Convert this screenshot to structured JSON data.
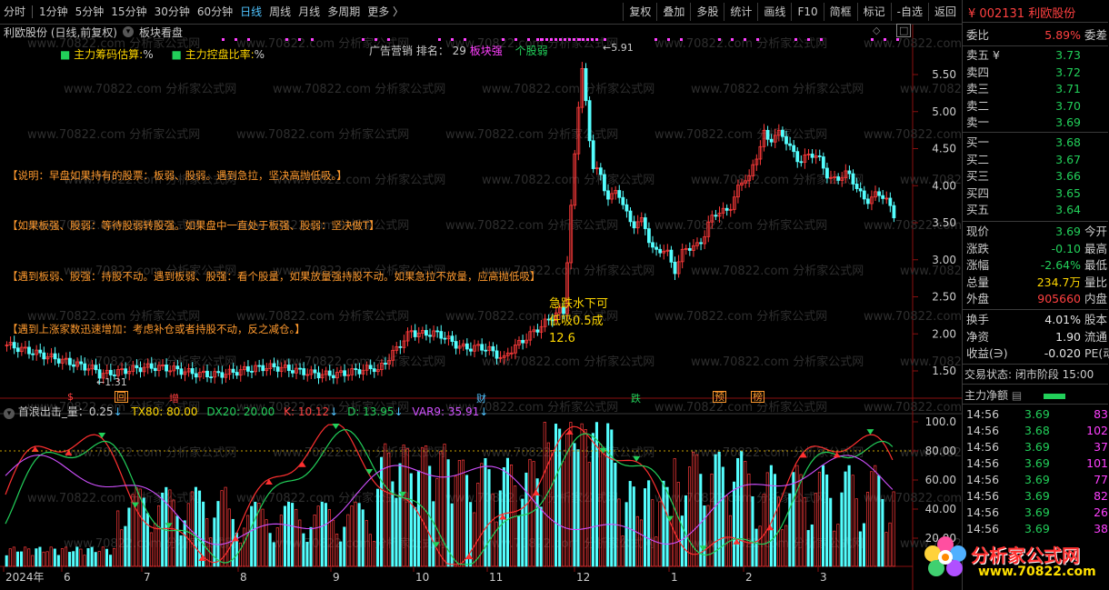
{
  "topbar": {
    "periods": [
      "分时",
      "1分钟",
      "5分钟",
      "15分钟",
      "30分钟",
      "60分钟",
      "日线",
      "周线",
      "月线",
      "多周期",
      "更多 〉"
    ],
    "active_period": "日线",
    "tools": [
      "复权",
      "叠加",
      "多股",
      "统计",
      "画线",
      "F10",
      "简框",
      "标记",
      "-自选",
      "返回"
    ]
  },
  "chart_title": {
    "stock": "利欧股份 (日线,前复权)",
    "selector": "板块看盘"
  },
  "indicators_top": {
    "item1": "主力筹码估算:",
    "item1_val": "%",
    "item2": "主力控盘比率:",
    "item2_val": "%",
    "rank": "广告营销 排名： 29",
    "sector_strong": "板块强",
    "stock_weak": "个股弱"
  },
  "notes": [
    "【说明：早盘如果持有的股票：板弱、股弱。遇到急拉，坚决高抛低吸。】",
    "【如果板强、股弱：等待股弱转股强。如果盘中一直处于板强、股弱：坚决做T】",
    "【遇到板弱、股强：持股不动。遇到板弱、股强：看个股量，如果放量强持股不动。如果急拉不放量，应高抛低吸】",
    "【遇到上涨家数迅速增加：考虑补仓或者持股不动，反之减仓。】"
  ],
  "annotations": {
    "high_label": "5.91",
    "low_label": "1.31",
    "callout_line1": "急跌水下可",
    "callout_line2": "低吸0.5成",
    "callout_line3": "12.6"
  },
  "event_markers": [
    "$",
    "回",
    "增",
    "财",
    "跌",
    "预",
    "榜"
  ],
  "price_axis": [
    "5.50",
    "5.00",
    "4.50",
    "4.00",
    "3.50",
    "3.00",
    "2.50",
    "2.00",
    "1.50"
  ],
  "sub_indicator": {
    "name": "首浪出击_量：0.25",
    "tx80": "TX80: 80.00",
    "dx20": "DX20: 20.00",
    "k": "K: 10.12",
    "d": "D: 13.95",
    "var9": "VAR9: 35.91"
  },
  "sub_axis": [
    "100.0",
    "80.00",
    "60.00",
    "40.00",
    "20.00"
  ],
  "date_axis": [
    "2024年",
    "6",
    "7",
    "8",
    "9",
    "10",
    "11",
    "12",
    "1",
    "2",
    "3"
  ],
  "watermark": "www.70822.com 分析家公式网",
  "right_panel": {
    "code": "002131",
    "name": "利欧股份",
    "weibi_label": "委比",
    "weibi": "5.89%",
    "weicha_label": "委差",
    "asks": [
      {
        "label": "卖五 ¥",
        "price": "3.73"
      },
      {
        "label": "卖四",
        "price": "3.72"
      },
      {
        "label": "卖三",
        "price": "3.71"
      },
      {
        "label": "卖二",
        "price": "3.70"
      },
      {
        "label": "卖一",
        "price": "3.69"
      }
    ],
    "bids": [
      {
        "label": "买一",
        "price": "3.68"
      },
      {
        "label": "买二",
        "price": "3.67"
      },
      {
        "label": "买三",
        "price": "3.66"
      },
      {
        "label": "买四",
        "price": "3.65"
      },
      {
        "label": "买五",
        "price": "3.64"
      }
    ],
    "stats": [
      {
        "l": "现价",
        "v": "3.69",
        "r": "今开",
        "c": "green"
      },
      {
        "l": "涨跌",
        "v": "-0.10",
        "r": "最高",
        "c": "green"
      },
      {
        "l": "涨幅",
        "v": "-2.64%",
        "r": "最低",
        "c": "green"
      },
      {
        "l": "总量",
        "v": "234.7万",
        "r": "量比",
        "c": "yellow"
      },
      {
        "l": "外盘",
        "v": "905660",
        "r": "内盘",
        "c": "red"
      }
    ],
    "stats2": [
      {
        "l": "换手",
        "v": "4.01%",
        "r": "股本",
        "c": "white"
      },
      {
        "l": "净资",
        "v": "1.90",
        "r": "流通",
        "c": "white"
      },
      {
        "l": "收益(∋)",
        "v": "-0.020",
        "r": "PE(动",
        "c": "white"
      }
    ],
    "trade_status": "交易状态: 闭市阶段 15:00",
    "net_label": "主力净额",
    "ticks": [
      {
        "t": "14:56",
        "p": "3.69",
        "v": "83"
      },
      {
        "t": "14:56",
        "p": "3.68",
        "v": "102"
      },
      {
        "t": "14:56",
        "p": "3.69",
        "v": "37"
      },
      {
        "t": "14:56",
        "p": "3.69",
        "v": "101"
      },
      {
        "t": "14:56",
        "p": "3.69",
        "v": "77"
      },
      {
        "t": "14:56",
        "p": "3.69",
        "v": "82"
      },
      {
        "t": "14:56",
        "p": "3.69",
        "v": "26"
      },
      {
        "t": "14:56",
        "p": "3.69",
        "v": "38"
      }
    ]
  },
  "logo": {
    "title": "分析家公式网",
    "url": "www.70822.com"
  }
}
